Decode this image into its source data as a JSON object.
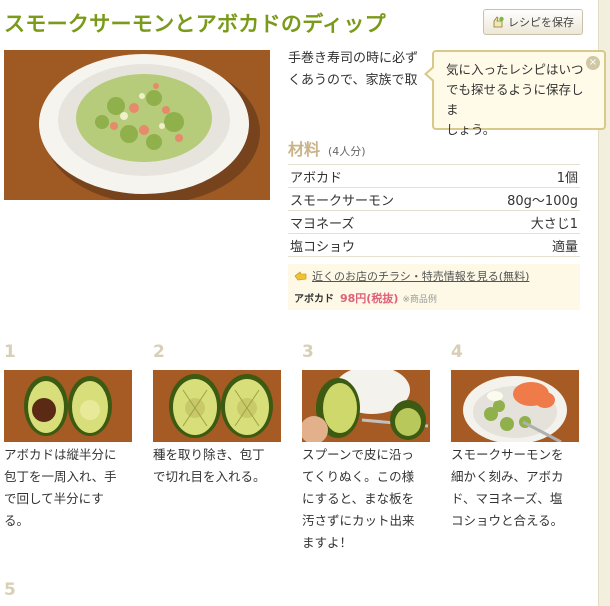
{
  "recipe": {
    "title": "スモークサーモンとアボカドのディップ",
    "save_label": "レシピを保存",
    "description_lines": [
      "手巻き寿司の時に必ず",
      "くあうので、家族で取"
    ]
  },
  "tooltip": {
    "lines": [
      "気に入ったレシピはいつ",
      "でも探せるように保存しま",
      "しょう。"
    ],
    "close_label": "×"
  },
  "ingredients": {
    "heading": "材料",
    "servings": "(4人分)",
    "items": [
      {
        "name": "アボカド",
        "amount": "1個"
      },
      {
        "name": "スモークサーモン",
        "amount": "80g〜100g"
      },
      {
        "name": "マヨネーズ",
        "amount": "大さじ1"
      },
      {
        "name": "塩コショウ",
        "amount": "適量"
      }
    ]
  },
  "promo": {
    "link_text": "近くのお店のチラシ・特売情報を見る(無料)",
    "item": "アボカド",
    "price": "98円(税抜)",
    "note": "※商品例"
  },
  "steps": [
    {
      "number": "1",
      "lines": [
        "アボカドは縦半分に",
        "包丁を一周入れ、手",
        "で回して半分にす",
        "る。"
      ]
    },
    {
      "number": "2",
      "lines": [
        "種を取り除き、包丁",
        "で切れ目を入れる。"
      ]
    },
    {
      "number": "3",
      "lines": [
        "スプーンで皮に沿っ",
        "てくりぬく。この様",
        "にすると、まな板を",
        "汚さずにカット出来",
        "ますよ！"
      ]
    },
    {
      "number": "4",
      "lines": [
        "スモークサーモンを",
        "細かく刻み、アボカ",
        "ド、マヨネーズ、塩",
        "コショウと合える。"
      ]
    },
    {
      "number": "5",
      "lines": []
    }
  ],
  "colors": {
    "title": "#7a9a1a",
    "accent_price": "#e0607a",
    "tooltip_bg": "#fffbe8"
  }
}
